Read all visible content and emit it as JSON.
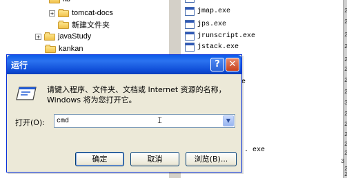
{
  "explorer_tree": {
    "items": [
      {
        "label": "lib",
        "expander": ""
      },
      {
        "label": "tomcat-docs",
        "expander": "+"
      },
      {
        "label": "新建文件夹",
        "expander": ""
      },
      {
        "label": "javaStudy",
        "expander": "+"
      },
      {
        "label": "kankan",
        "expander": ""
      }
    ]
  },
  "file_list": {
    "items": [
      "jmap.exe",
      "jps.exe",
      "jrunscript.exe",
      "jstack.exe"
    ],
    "partial_labels": [
      "e",
      ". exe"
    ]
  },
  "right_column_digits": [
    "2",
    "2",
    "2",
    "2",
    "2",
    "2",
    "2",
    "2",
    "3",
    "2",
    "2",
    "2",
    "2",
    "2",
    "3",
    "2",
    "2"
  ],
  "run_dialog": {
    "title": "运行",
    "help_label": "?",
    "close_label": "✕",
    "description": "请键入程序、文件夹、文档或 Internet 资源的名称，Windows 将为您打开它。",
    "open_label": "打开(O):",
    "open_value": "cmd",
    "ok_label": "确定",
    "cancel_label": "取消",
    "browse_label": "浏览(B)..."
  },
  "icons": {
    "run": "run-icon",
    "folder": "folder-icon",
    "exe": "exe-icon",
    "dropdown": "chevron-down-icon",
    "cursor": "text-cursor-icon"
  },
  "colors": {
    "titlebar": "#0a5ae8",
    "close": "#c8421e",
    "dialog_bg": "#ece9d8"
  }
}
